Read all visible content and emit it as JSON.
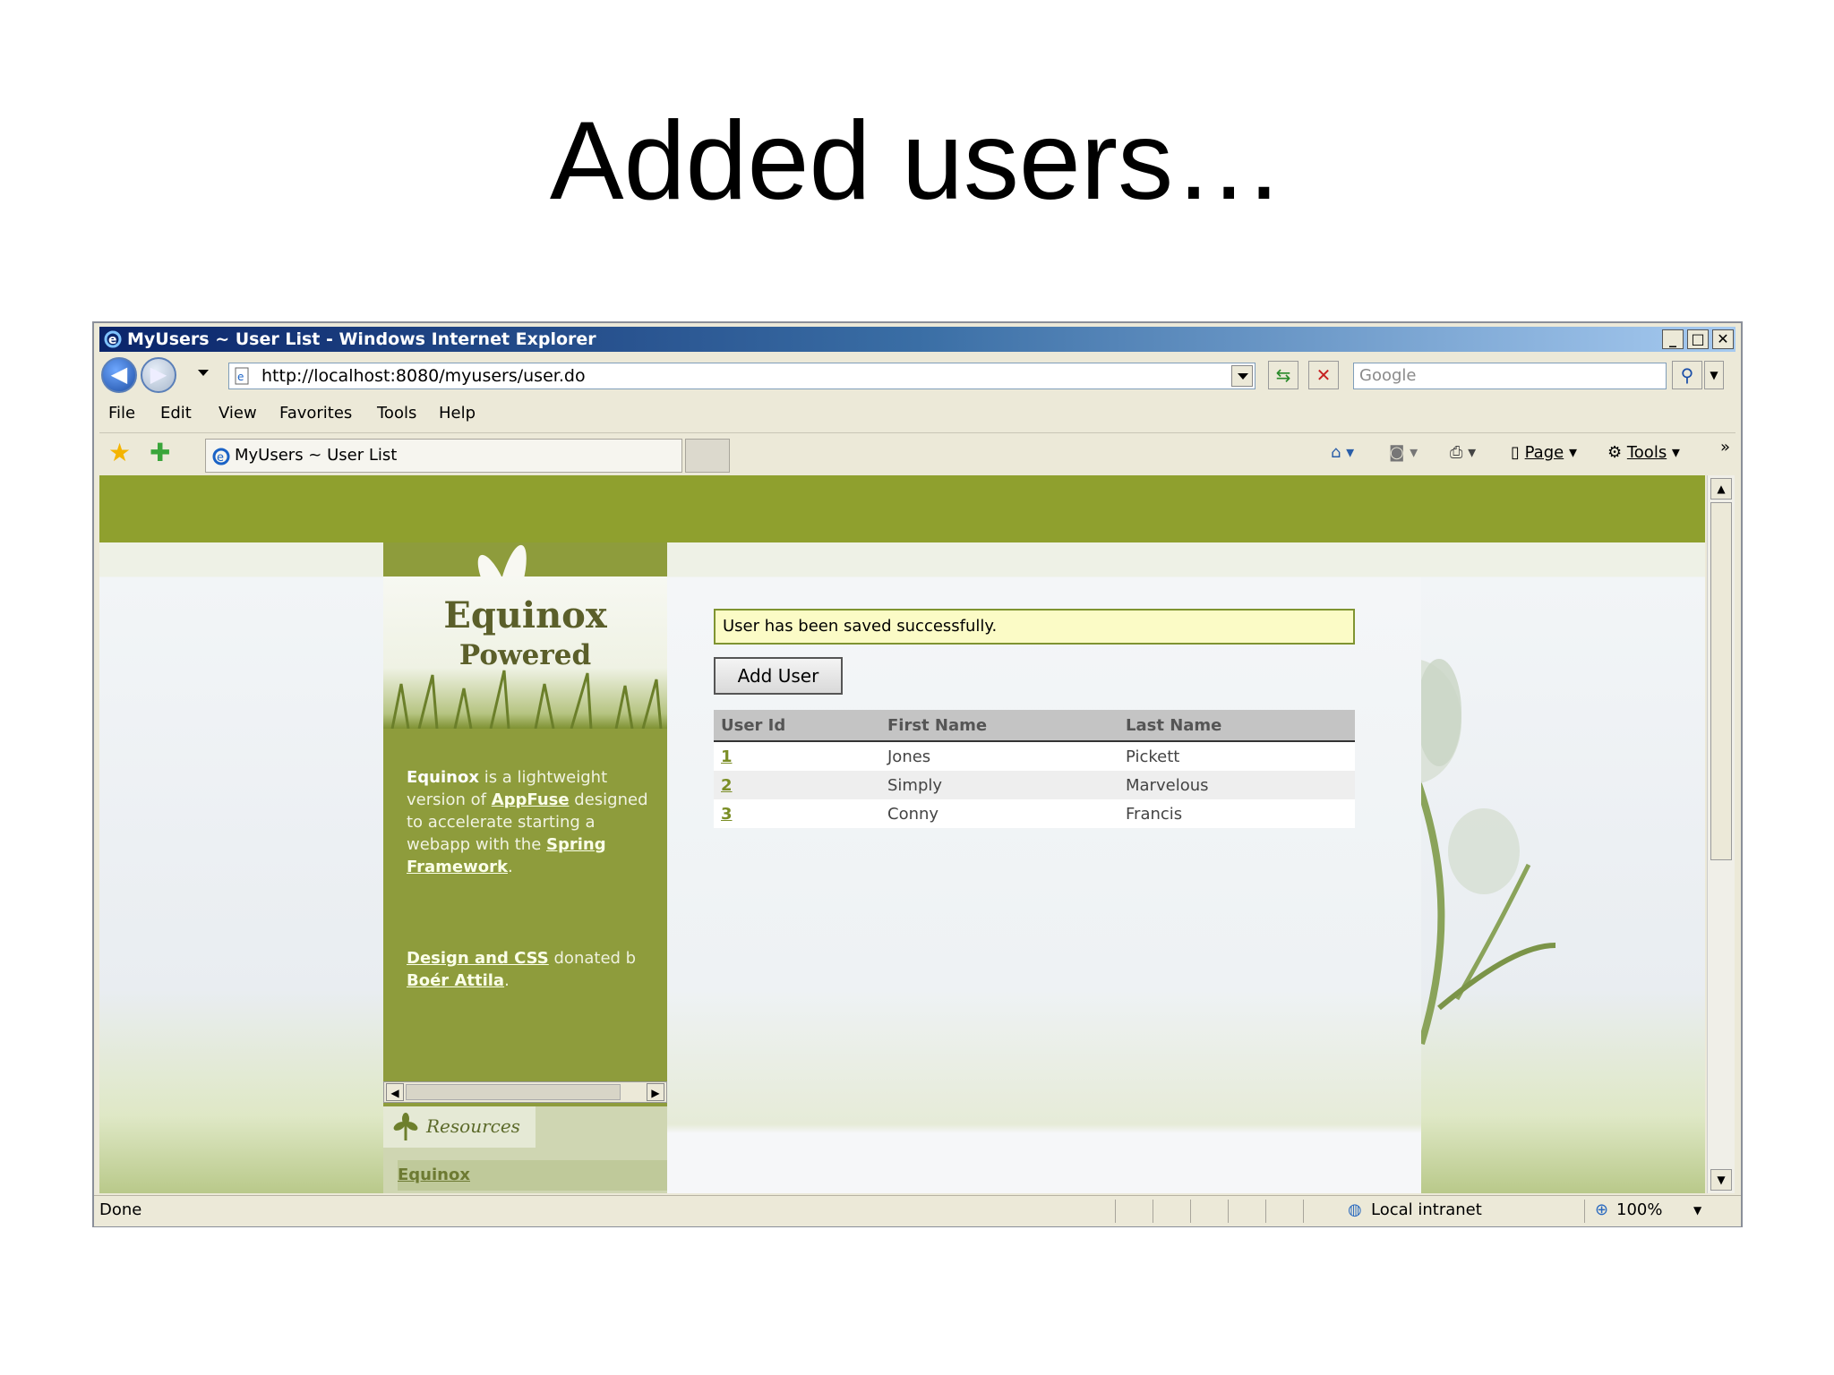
{
  "slide": {
    "title": "Added users…"
  },
  "browser": {
    "window_title": "MyUsers ~ User List - Windows Internet Explorer",
    "address": "http://localhost:8080/myusers/user.do",
    "search_placeholder": "Google",
    "menu": [
      "File",
      "Edit",
      "View",
      "Favorites",
      "Tools",
      "Help"
    ],
    "tab_label": "MyUsers ~ User List",
    "commands": {
      "page": "Page",
      "tools": "Tools"
    },
    "status": {
      "left": "Done",
      "zone": "Local intranet",
      "zoom": "100%"
    }
  },
  "sidebar": {
    "logo_line1": "Equinox",
    "logo_line2": "Powered",
    "desc_name": "Equinox",
    "desc_part1": " is a lightweight version of ",
    "desc_link1": "AppFuse",
    "desc_part2": " designed to accelerate starting a webapp with the ",
    "desc_link2": "Spring Framework",
    "desc_part3": ".",
    "credits_link1": "Design and CSS",
    "credits_part1": " donated b",
    "credits_link2": "Boér Attila",
    "credits_part2": ".",
    "resources_title": "Resources",
    "resources_link": "Equinox"
  },
  "main": {
    "message": "User has been saved successfully.",
    "add_button": "Add User",
    "columns": [
      "User Id",
      "First Name",
      "Last Name"
    ],
    "rows": [
      [
        "1",
        "Jones",
        "Pickett"
      ],
      [
        "2",
        "Simply",
        "Marvelous"
      ],
      [
        "3",
        "Conny",
        "Francis"
      ]
    ]
  }
}
